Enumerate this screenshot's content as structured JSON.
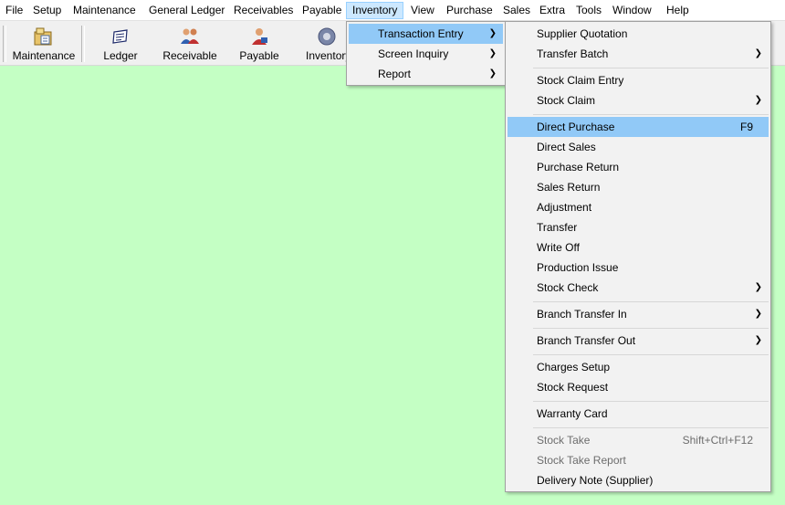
{
  "menubar": {
    "items": [
      "File",
      "Setup",
      "Maintenance",
      "General Ledger",
      "Receivables",
      "Payable",
      "Inventory",
      "View",
      "Purchase",
      "Sales",
      "Extra",
      "Tools",
      "Window",
      "Help"
    ]
  },
  "toolbar": {
    "buttons": [
      {
        "label": "Maintenance",
        "icon": "maintenance-icon"
      },
      {
        "label": "Ledger",
        "icon": "ledger-icon"
      },
      {
        "label": "Receivable",
        "icon": "receivable-icon"
      },
      {
        "label": "Payable",
        "icon": "payable-icon"
      },
      {
        "label": "Inventory",
        "icon": "inventory-icon"
      }
    ]
  },
  "inventory_menu": {
    "items": [
      {
        "label": "Transaction Entry",
        "submenu": true
      },
      {
        "label": "Screen Inquiry",
        "submenu": true
      },
      {
        "label": "Report",
        "submenu": true
      }
    ]
  },
  "transaction_menu": {
    "items": [
      {
        "label": "Supplier Quotation"
      },
      {
        "label": "Transfer Batch",
        "submenu": true
      },
      {
        "label": "Stock Claim Entry"
      },
      {
        "label": "Stock Claim",
        "submenu": true
      },
      {
        "label": "Direct Purchase",
        "shortcut": "F9"
      },
      {
        "label": "Direct Sales"
      },
      {
        "label": "Purchase Return"
      },
      {
        "label": "Sales Return"
      },
      {
        "label": "Adjustment"
      },
      {
        "label": "Transfer"
      },
      {
        "label": "Write Off"
      },
      {
        "label": "Production Issue"
      },
      {
        "label": "Stock Check",
        "submenu": true
      },
      {
        "label": "Branch Transfer In",
        "submenu": true
      },
      {
        "label": "Branch Transfer Out",
        "submenu": true
      },
      {
        "label": "Charges Setup"
      },
      {
        "label": "Stock Request"
      },
      {
        "label": "Warranty Card"
      },
      {
        "label": "Stock Take",
        "shortcut": "Shift+Ctrl+F12",
        "disabled": true
      },
      {
        "label": "Stock Take Report",
        "disabled": true
      },
      {
        "label": "Delivery Note (Supplier)"
      }
    ]
  },
  "colors": {
    "workspace_bg": "#c4ffc4",
    "menu_highlight": "#91c9f7",
    "menubar_active": "#cce8ff"
  }
}
